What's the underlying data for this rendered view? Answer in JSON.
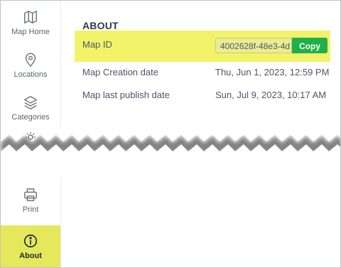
{
  "sidebar": {
    "items": [
      {
        "label": "Map Home",
        "icon": "map-icon"
      },
      {
        "label": "Locations",
        "icon": "location-pin-icon"
      },
      {
        "label": "Categories",
        "icon": "layers-icon"
      },
      {
        "label": "Print",
        "icon": "printer-icon"
      },
      {
        "label": "About",
        "icon": "info-icon",
        "active": true
      }
    ]
  },
  "about": {
    "title": "ABOUT",
    "map_id_label": "Map ID",
    "map_id_value": "4002628f-48e3-4d",
    "copy_label": "Copy",
    "creation_label": "Map Creation date",
    "creation_value": "Thu, Jun 1, 2023, 12:59 PM",
    "publish_label": "Map last publish date",
    "publish_value": "Sun, Jul 9, 2023, 10:17 AM"
  },
  "colors": {
    "highlight": "#f3f36a",
    "active_nav": "#e6e85c",
    "copy_button": "#1fb04b"
  }
}
